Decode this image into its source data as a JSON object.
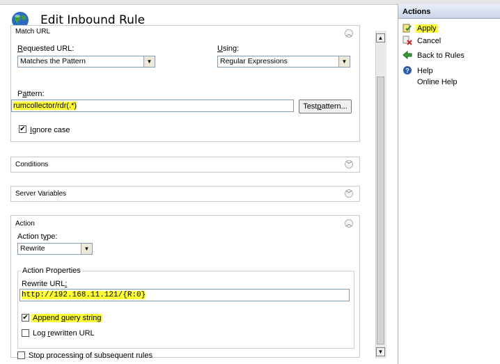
{
  "page": {
    "title": "Edit Inbound Rule"
  },
  "match_url": {
    "header": "Match URL",
    "requested_url_label": "Requested URL:",
    "requested_url_value": "Matches the Pattern",
    "using_label": "Using:",
    "using_value": "Regular Expressions",
    "pattern_label": "Pattern:",
    "pattern_value": "rumcollector/rdr(.*)",
    "test_pattern_label": "Test pattern...",
    "ignore_case_label": "Ignore case",
    "ignore_case_checked": true
  },
  "conditions": {
    "header": "Conditions"
  },
  "server_variables": {
    "header": "Server Variables"
  },
  "action": {
    "header": "Action",
    "action_type_label": "Action type:",
    "action_type_value": "Rewrite",
    "properties_legend": "Action Properties",
    "rewrite_url_label": "Rewrite URL:",
    "rewrite_url_value": "http://192.168.11.121/{R:0}",
    "append_query_label": "Append query string",
    "append_query_checked": true,
    "log_rewritten_label": "Log rewritten URL",
    "log_rewritten_checked": false,
    "stop_processing_label": "Stop processing of subsequent rules",
    "stop_processing_checked": false
  },
  "actions_pane": {
    "header": "Actions",
    "apply": "Apply",
    "cancel": "Cancel",
    "back_to_rules": "Back to Rules",
    "help": "Help",
    "online_help": "Online Help"
  },
  "colors": {
    "highlight": "#ffff33",
    "pane_header": "#cbd6e8"
  }
}
